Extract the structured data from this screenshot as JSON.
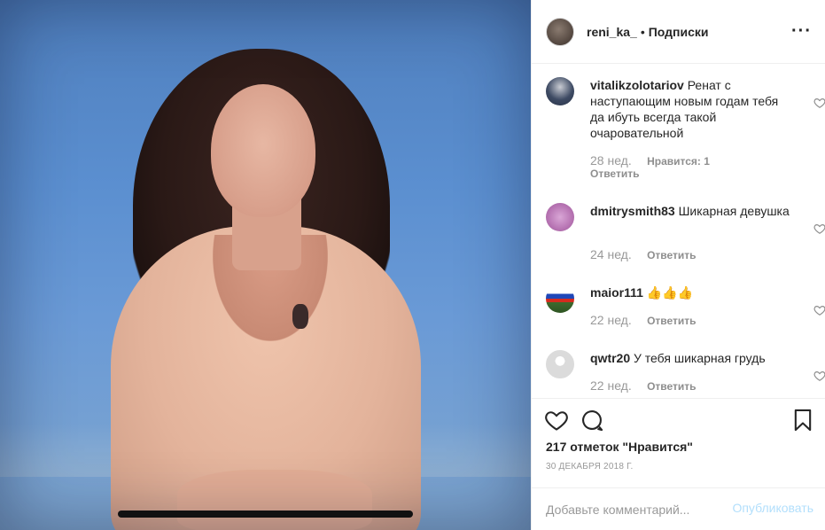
{
  "post": {
    "author": "reni_ka_",
    "separator": "•",
    "follow_label": "Подписки",
    "more_icon": "more-icon"
  },
  "comments": [
    {
      "user": "vitalikzolotariov",
      "text": "Ренат с наступающим новым годам тебя да ибуть всегда такой очаровательной",
      "time": "28 нед.",
      "likes": "Нравится: 1",
      "reply": "Ответить"
    },
    {
      "user": "dmitrysmith83",
      "text": "Шикарная девушка",
      "time": "24 нед.",
      "reply": "Ответить"
    },
    {
      "user": "maior111",
      "text": "👍👍👍",
      "time": "22 нед.",
      "reply": "Ответить"
    },
    {
      "user": "qwtr20",
      "text": "У тебя шикарная грудь",
      "time": "22 нед.",
      "reply": "Ответить"
    }
  ],
  "stats": {
    "likes_label": "217 отметок \"Нравится\"",
    "date": "30 декабря 2018 г."
  },
  "composer": {
    "placeholder": "Добавьте комментарий...",
    "publish_label": "Опубликовать"
  },
  "colors": {
    "text": "#262626",
    "muted": "#8e8e8e",
    "publish_disabled": "#b2dffc",
    "border": "#efefef"
  }
}
